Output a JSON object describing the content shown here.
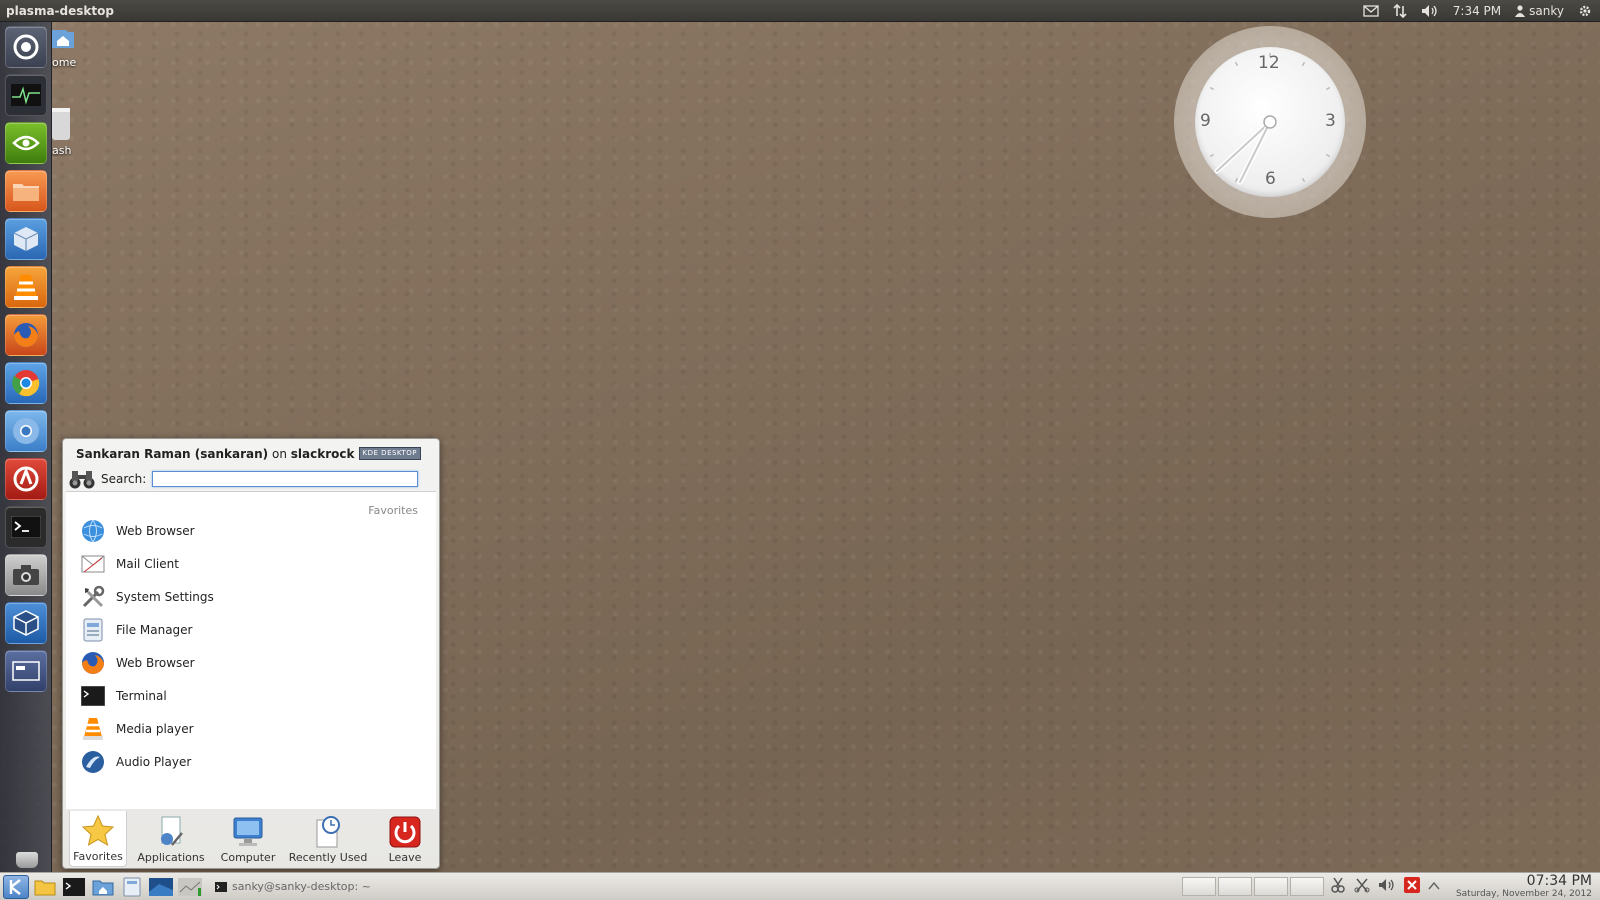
{
  "top_panel": {
    "title": "plasma-desktop",
    "time": "7:34 PM",
    "user": "sanky"
  },
  "desktop": {
    "home_label": "ome",
    "trash_label": "ash"
  },
  "clock_widget": {
    "numerals": [
      "12",
      "3",
      "6",
      "9"
    ]
  },
  "launcher": {
    "items": [
      "dash-icon",
      "system-monitor-icon",
      "nvidia-icon",
      "files-icon",
      "cube-icon",
      "vlc-icon",
      "firefox-icon",
      "chrome-icon",
      "chromium-icon",
      "app-icon",
      "terminal-icon",
      "camera-icon",
      "virtualbox-icon",
      "workspace-icon"
    ]
  },
  "menu": {
    "user_name": "Sankaran Raman (sankaran)",
    "on_text": "on",
    "host": "slackrock",
    "badge": "KDE DESKTOP",
    "search_label": "Search:",
    "search_value": "",
    "favorites_caption": "Favorites",
    "favorites": [
      {
        "label": "Web Browser",
        "icon": "globe-icon"
      },
      {
        "label": "Mail Client",
        "icon": "mail-icon"
      },
      {
        "label": "System Settings",
        "icon": "tools-icon"
      },
      {
        "label": "File Manager",
        "icon": "file-manager-icon"
      },
      {
        "label": "Web Browser",
        "icon": "firefox-icon"
      },
      {
        "label": "Terminal",
        "icon": "terminal-icon"
      },
      {
        "label": "Media player",
        "icon": "vlc-icon"
      },
      {
        "label": "Audio Player",
        "icon": "audio-icon"
      }
    ],
    "tabs": [
      {
        "label": "Favorites",
        "icon": "star-icon",
        "active": true
      },
      {
        "label": "Applications",
        "icon": "applications-icon",
        "active": false
      },
      {
        "label": "Computer",
        "icon": "computer-icon",
        "active": false
      },
      {
        "label": "Recently Used",
        "icon": "clock-icon",
        "active": false
      },
      {
        "label": "Leave",
        "icon": "power-icon",
        "active": false
      }
    ]
  },
  "taskbar": {
    "task_label": "sanky@sanky-desktop: ~",
    "time": "07:34 PM",
    "date": "Saturday, November 24, 2012"
  },
  "colors": {
    "accent": "#4d84c7",
    "panel": "#3a3834",
    "leave_red": "#d7261e"
  }
}
